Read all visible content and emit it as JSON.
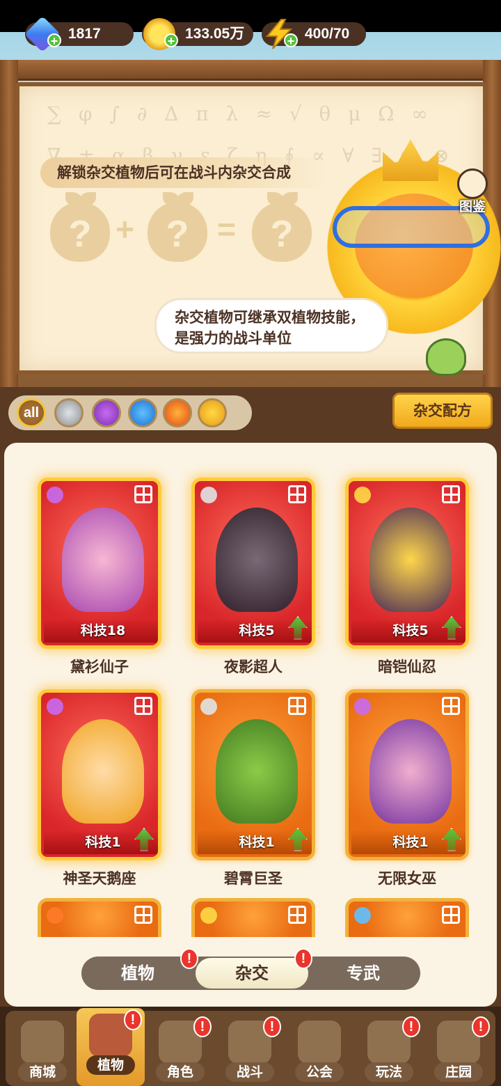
{
  "resources": {
    "gems": "1817",
    "coins": "133.05万",
    "energy": "400/70"
  },
  "board": {
    "unlock_text": "解锁杂交植物后可在战斗内杂交合成",
    "placeholder": "?",
    "plus": "+",
    "equals": "=",
    "speech": "杂交植物可继承双植物技能，是强力的战斗单位",
    "gallery_label": "图鉴"
  },
  "filters": {
    "all_label": "all",
    "items": [
      "sword",
      "potion",
      "water",
      "fire",
      "bolt"
    ],
    "recipe_button": "杂交配方"
  },
  "cards": [
    {
      "name": "黛衫仙子",
      "level": "科技18",
      "theme": "red",
      "type": "potion",
      "upgrade": false
    },
    {
      "name": "夜影超人",
      "level": "科技5",
      "theme": "red",
      "type": "sword",
      "upgrade": true
    },
    {
      "name": "暗铠仙忍",
      "level": "科技5",
      "theme": "red",
      "type": "bolt",
      "upgrade": true
    },
    {
      "name": "神圣天鹅座",
      "level": "科技1",
      "theme": "red",
      "type": "potion",
      "upgrade": true
    },
    {
      "name": "碧霄巨圣",
      "level": "科技1",
      "theme": "orange",
      "type": "sword",
      "upgrade": true
    },
    {
      "name": "无限女巫",
      "level": "科技1",
      "theme": "orange",
      "type": "potion",
      "upgrade": true
    }
  ],
  "partial_cards": [
    {
      "type": "fire"
    },
    {
      "type": "bolt"
    },
    {
      "type": "water"
    }
  ],
  "tabs": [
    {
      "label": "植物",
      "alert": "!"
    },
    {
      "label": "杂交",
      "alert": "!"
    },
    {
      "label": "专武",
      "alert": ""
    }
  ],
  "nav": [
    {
      "label": "商城",
      "alert": ""
    },
    {
      "label": "植物",
      "alert": "!"
    },
    {
      "label": "角色",
      "alert": "!"
    },
    {
      "label": "战斗",
      "alert": "!"
    },
    {
      "label": "公会",
      "alert": ""
    },
    {
      "label": "玩法",
      "alert": "!"
    },
    {
      "label": "庄园",
      "alert": "!"
    }
  ],
  "colors": {
    "accent": "#ffcb3a",
    "brown": "#4b3124",
    "alert": "#e9352c",
    "upgrade": "#56c43a"
  }
}
